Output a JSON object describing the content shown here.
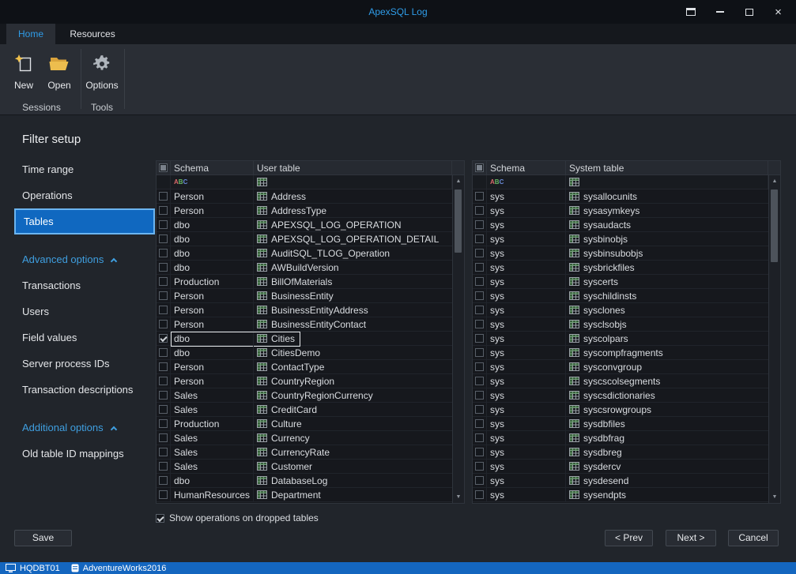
{
  "window": {
    "title": "ApexSQL Log"
  },
  "tabs": {
    "home": "Home",
    "resources": "Resources"
  },
  "ribbon": {
    "new_label": "New",
    "open_label": "Open",
    "options_label": "Options",
    "group_sessions": "Sessions",
    "group_tools": "Tools"
  },
  "sidebar": {
    "heading": "Filter setup",
    "items": [
      {
        "label": "Time range",
        "kind": "item"
      },
      {
        "label": "Operations",
        "kind": "item"
      },
      {
        "label": "Tables",
        "kind": "item",
        "selected": true
      },
      {
        "label": "Advanced options",
        "kind": "section"
      },
      {
        "label": "Transactions",
        "kind": "item"
      },
      {
        "label": "Users",
        "kind": "item"
      },
      {
        "label": "Field values",
        "kind": "item"
      },
      {
        "label": "Server process IDs",
        "kind": "item"
      },
      {
        "label": "Transaction descriptions",
        "kind": "item"
      },
      {
        "label": "Additional options",
        "kind": "section"
      },
      {
        "label": "Old table ID mappings",
        "kind": "item"
      }
    ]
  },
  "user_tables": {
    "columns": {
      "schema": "Schema",
      "table": "User table"
    },
    "header_checkbox": "filled",
    "rows": [
      {
        "schema": "Person",
        "table": "Address",
        "checked": false
      },
      {
        "schema": "Person",
        "table": "AddressType",
        "checked": false
      },
      {
        "schema": "dbo",
        "table": "APEXSQL_LOG_OPERATION",
        "checked": false
      },
      {
        "schema": "dbo",
        "table": "APEXSQL_LOG_OPERATION_DETAIL",
        "checked": false
      },
      {
        "schema": "dbo",
        "table": "AuditSQL_TLOG_Operation",
        "checked": false
      },
      {
        "schema": "dbo",
        "table": "AWBuildVersion",
        "checked": false
      },
      {
        "schema": "Production",
        "table": "BillOfMaterials",
        "checked": false
      },
      {
        "schema": "Person",
        "table": "BusinessEntity",
        "checked": false
      },
      {
        "schema": "Person",
        "table": "BusinessEntityAddress",
        "checked": false
      },
      {
        "schema": "Person",
        "table": "BusinessEntityContact",
        "checked": false
      },
      {
        "schema": "dbo",
        "table": "Cities",
        "checked": true,
        "focused": true
      },
      {
        "schema": "dbo",
        "table": "CitiesDemo",
        "checked": false
      },
      {
        "schema": "Person",
        "table": "ContactType",
        "checked": false
      },
      {
        "schema": "Person",
        "table": "CountryRegion",
        "checked": false
      },
      {
        "schema": "Sales",
        "table": "CountryRegionCurrency",
        "checked": false
      },
      {
        "schema": "Sales",
        "table": "CreditCard",
        "checked": false
      },
      {
        "schema": "Production",
        "table": "Culture",
        "checked": false
      },
      {
        "schema": "Sales",
        "table": "Currency",
        "checked": false
      },
      {
        "schema": "Sales",
        "table": "CurrencyRate",
        "checked": false
      },
      {
        "schema": "Sales",
        "table": "Customer",
        "checked": false
      },
      {
        "schema": "dbo",
        "table": "DatabaseLog",
        "checked": false
      },
      {
        "schema": "HumanResources",
        "table": "Department",
        "checked": false
      }
    ]
  },
  "system_tables": {
    "columns": {
      "schema": "Schema",
      "table": "System table"
    },
    "header_checkbox": "filled",
    "rows": [
      {
        "schema": "sys",
        "table": "sysallocunits",
        "checked": false
      },
      {
        "schema": "sys",
        "table": "sysasymkeys",
        "checked": false
      },
      {
        "schema": "sys",
        "table": "sysaudacts",
        "checked": false
      },
      {
        "schema": "sys",
        "table": "sysbinobjs",
        "checked": false
      },
      {
        "schema": "sys",
        "table": "sysbinsubobjs",
        "checked": false
      },
      {
        "schema": "sys",
        "table": "sysbrickfiles",
        "checked": false
      },
      {
        "schema": "sys",
        "table": "syscerts",
        "checked": false
      },
      {
        "schema": "sys",
        "table": "syschildinsts",
        "checked": false
      },
      {
        "schema": "sys",
        "table": "sysclones",
        "checked": false
      },
      {
        "schema": "sys",
        "table": "sysclsobjs",
        "checked": false
      },
      {
        "schema": "sys",
        "table": "syscolpars",
        "checked": false
      },
      {
        "schema": "sys",
        "table": "syscompfragments",
        "checked": false
      },
      {
        "schema": "sys",
        "table": "sysconvgroup",
        "checked": false
      },
      {
        "schema": "sys",
        "table": "syscscolsegments",
        "checked": false
      },
      {
        "schema": "sys",
        "table": "syscsdictionaries",
        "checked": false
      },
      {
        "schema": "sys",
        "table": "syscsrowgroups",
        "checked": false
      },
      {
        "schema": "sys",
        "table": "sysdbfiles",
        "checked": false
      },
      {
        "schema": "sys",
        "table": "sysdbfrag",
        "checked": false
      },
      {
        "schema": "sys",
        "table": "sysdbreg",
        "checked": false
      },
      {
        "schema": "sys",
        "table": "sysdercv",
        "checked": false
      },
      {
        "schema": "sys",
        "table": "sysdesend",
        "checked": false
      },
      {
        "schema": "sys",
        "table": "sysendpts",
        "checked": false
      }
    ]
  },
  "footer": {
    "dropped_tables_label": "Show operations on dropped tables",
    "dropped_tables_checked": true,
    "save_label": "Save",
    "prev_label": "< Prev",
    "next_label": "Next >",
    "cancel_label": "Cancel"
  },
  "statusbar": {
    "server": "HQDBT01",
    "database": "AdventureWorks2016"
  },
  "icons": {
    "titlebar": [
      "panel-icon",
      "minimize-icon",
      "maximize-icon",
      "close-icon"
    ],
    "ribbon": {
      "new": "document-sparkle-icon",
      "open": "open-folder-icon",
      "options": "gear-icon"
    },
    "grid": {
      "text_filter": "abc-filter-icon",
      "table": "table-grid-icon"
    },
    "statusbar": {
      "server": "computer-icon",
      "database": "database-icon"
    }
  },
  "colors": {
    "accent": "#2f9ce8",
    "selection_bg": "#1068c0",
    "selection_border": "#6cb5f0",
    "statusbar_bg": "#1466bf"
  }
}
